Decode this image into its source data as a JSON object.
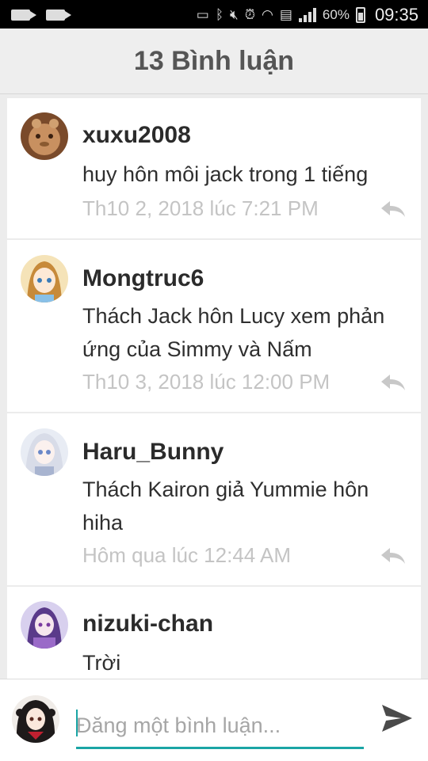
{
  "status_bar": {
    "battery_percent": "60%",
    "time": "09:35"
  },
  "header": {
    "title": "13 Bình luận"
  },
  "comments": [
    {
      "username": "xuxu2008",
      "text": "huy hôn môi jack trong 1 tiếng",
      "time": "Th10 2, 2018 lúc 7:21 PM"
    },
    {
      "username": "Mongtruc6",
      "text": "Thách Jack hôn Lucy xem phản ứng của Simmy và Nấm",
      "time": "Th10 3, 2018 lúc 12:00 PM"
    },
    {
      "username": "Haru_Bunny",
      "text": "Thách Kairon giả Yummie hôn hiha",
      "time": "Hôm qua lúc 12:44 AM"
    },
    {
      "username": "nizuki-chan",
      "text": "Trời",
      "time": ""
    }
  ],
  "input": {
    "placeholder": "Đăng một bình luận..."
  },
  "colors": {
    "accent": "#1aa5a5",
    "header_bg": "#eeeeee",
    "timestamp": "#c4c4c4"
  }
}
